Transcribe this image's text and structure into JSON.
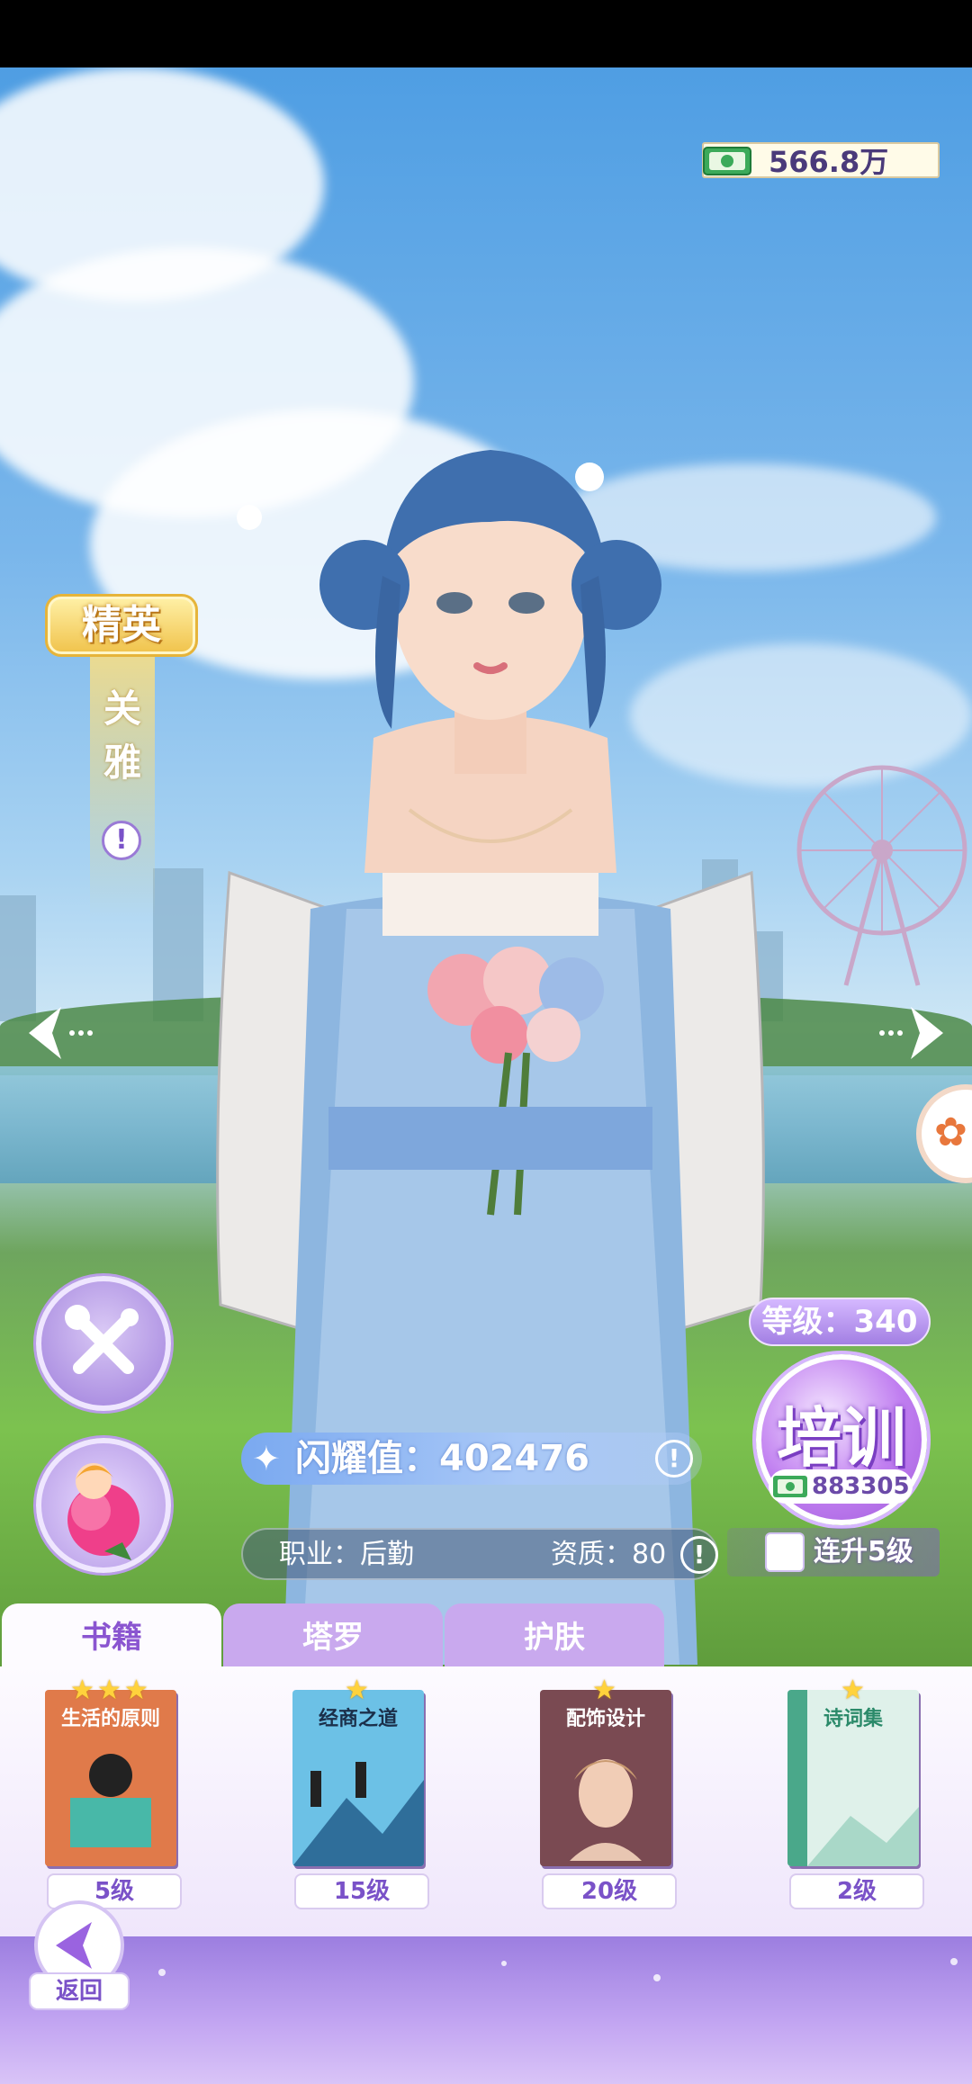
{
  "currency": {
    "amount": "566.8万"
  },
  "character": {
    "rank": "精英",
    "name": "关雅",
    "level_label": "等级：340",
    "shine_label": "闪耀值：402476",
    "job_label": "职业：后勤",
    "quality_label": "资质：80"
  },
  "train": {
    "label": "培训",
    "cost": "883305"
  },
  "levelup": {
    "label": "连升5级",
    "checked": false
  },
  "tabs": [
    {
      "label": "书籍",
      "active": true
    },
    {
      "label": "塔罗",
      "active": false
    },
    {
      "label": "护肤",
      "active": false
    }
  ],
  "books": [
    {
      "title": "生活的原则",
      "stars": 3,
      "level": "5级",
      "color": "#e07a4a"
    },
    {
      "title": "经商之道",
      "stars": 1,
      "level": "15级",
      "color": "#6cc1e6"
    },
    {
      "title": "配饰设计",
      "stars": 1,
      "level": "20级",
      "color": "#7a4a52"
    },
    {
      "title": "诗词集",
      "stars": 1,
      "level": "2级",
      "color": "#dff1ea"
    }
  ],
  "footer": {
    "back_label": "返回"
  },
  "colors": {
    "accent": "#8a55d0",
    "gold": "#f0c24a",
    "money_green": "#3caa5a"
  }
}
